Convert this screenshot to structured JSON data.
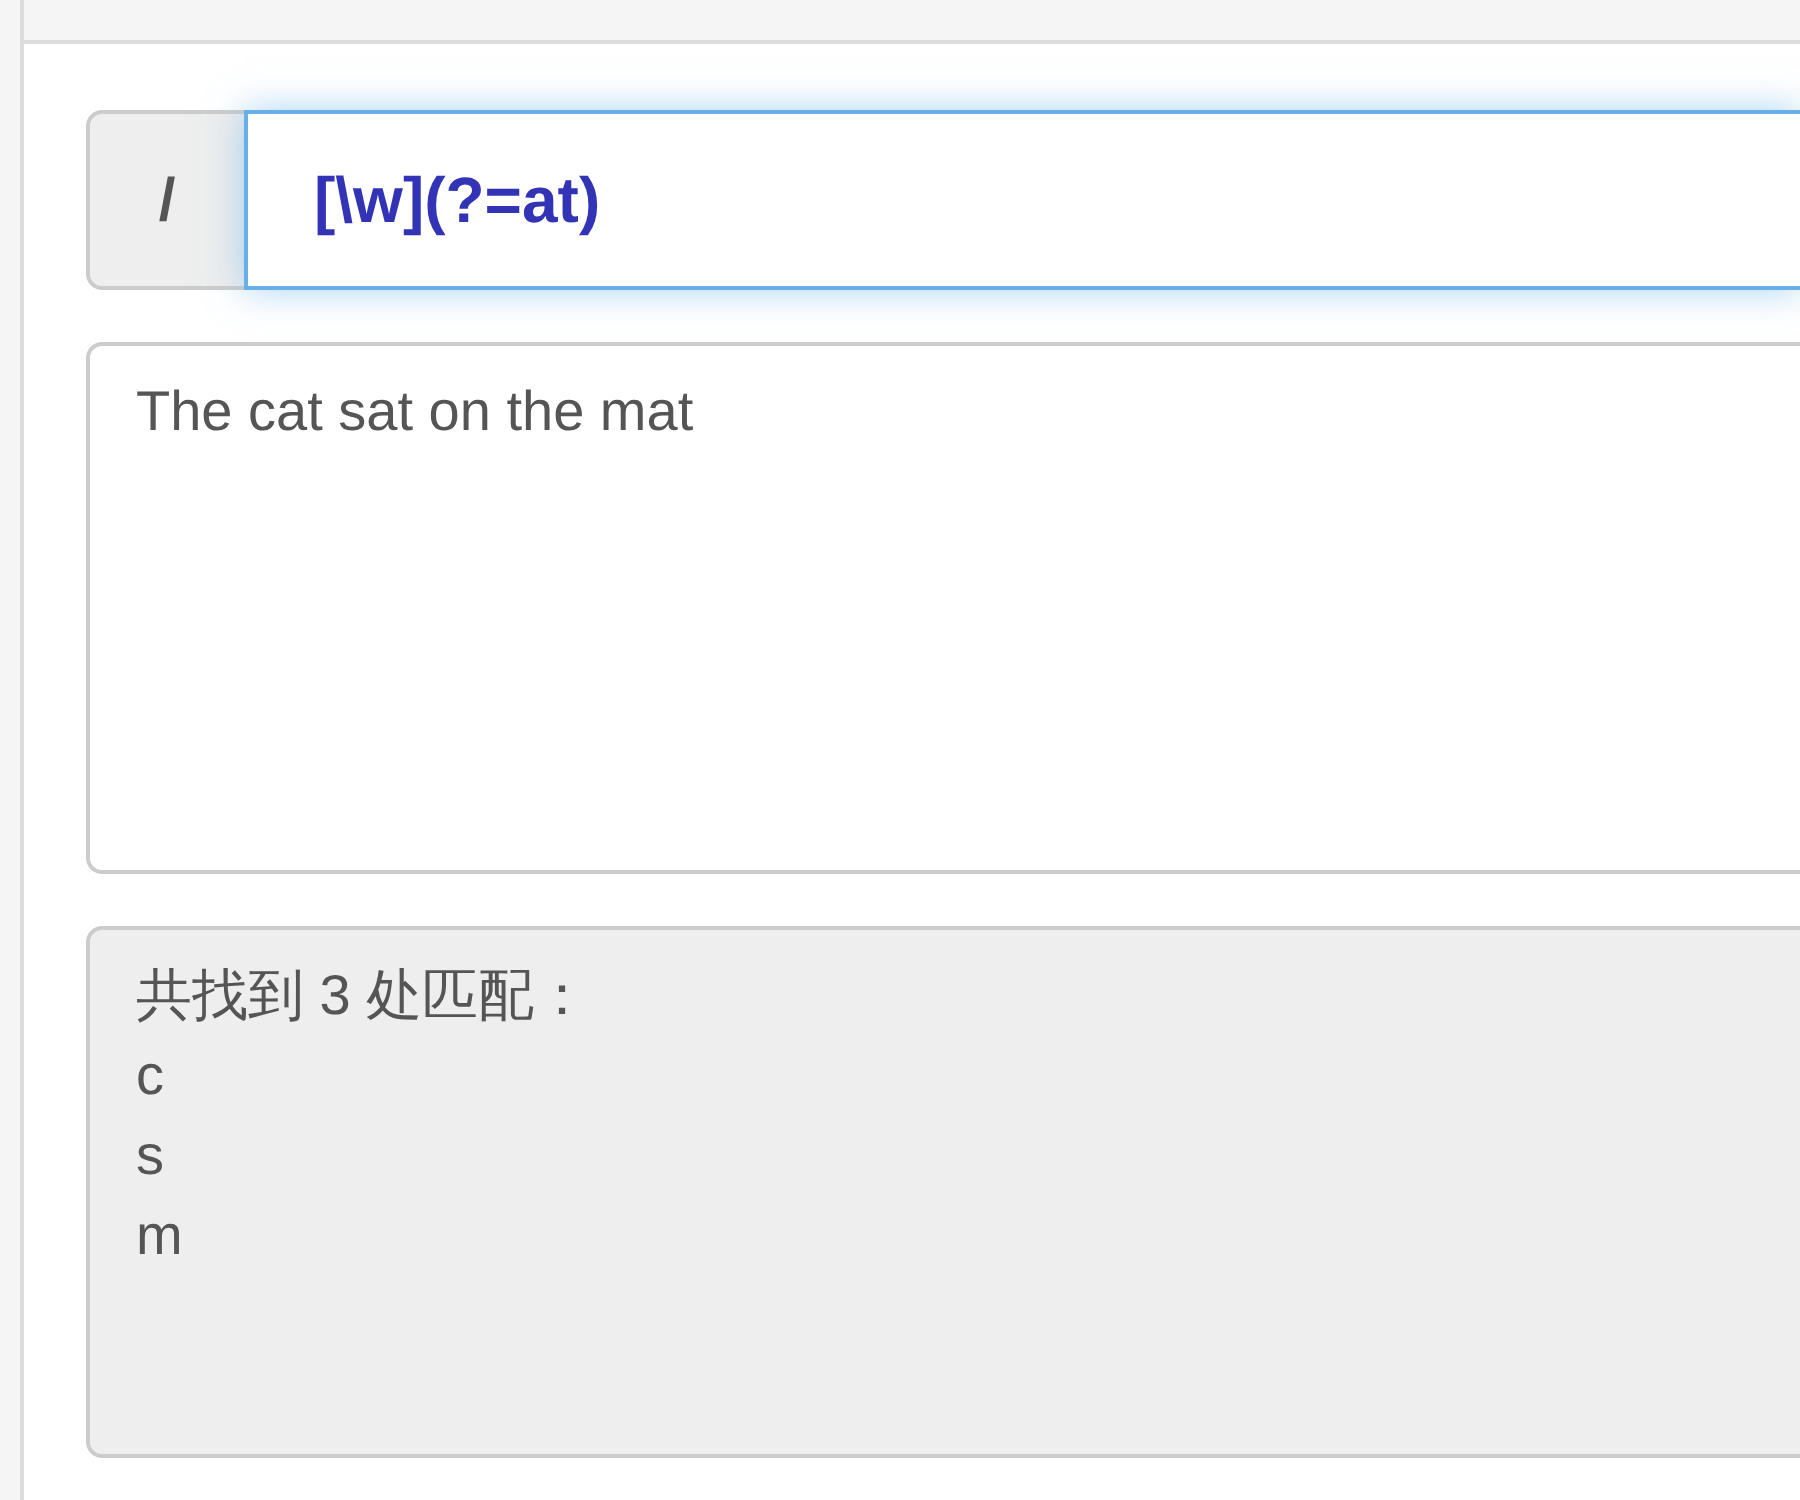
{
  "regex": {
    "delimiter": "/",
    "value": "[\\w](?=at)",
    "focused": true
  },
  "test_text": {
    "value": "The cat sat on the mat"
  },
  "result": {
    "summary": "共找到 3 处匹配：",
    "matches": [
      "c",
      "s",
      "m"
    ]
  }
}
